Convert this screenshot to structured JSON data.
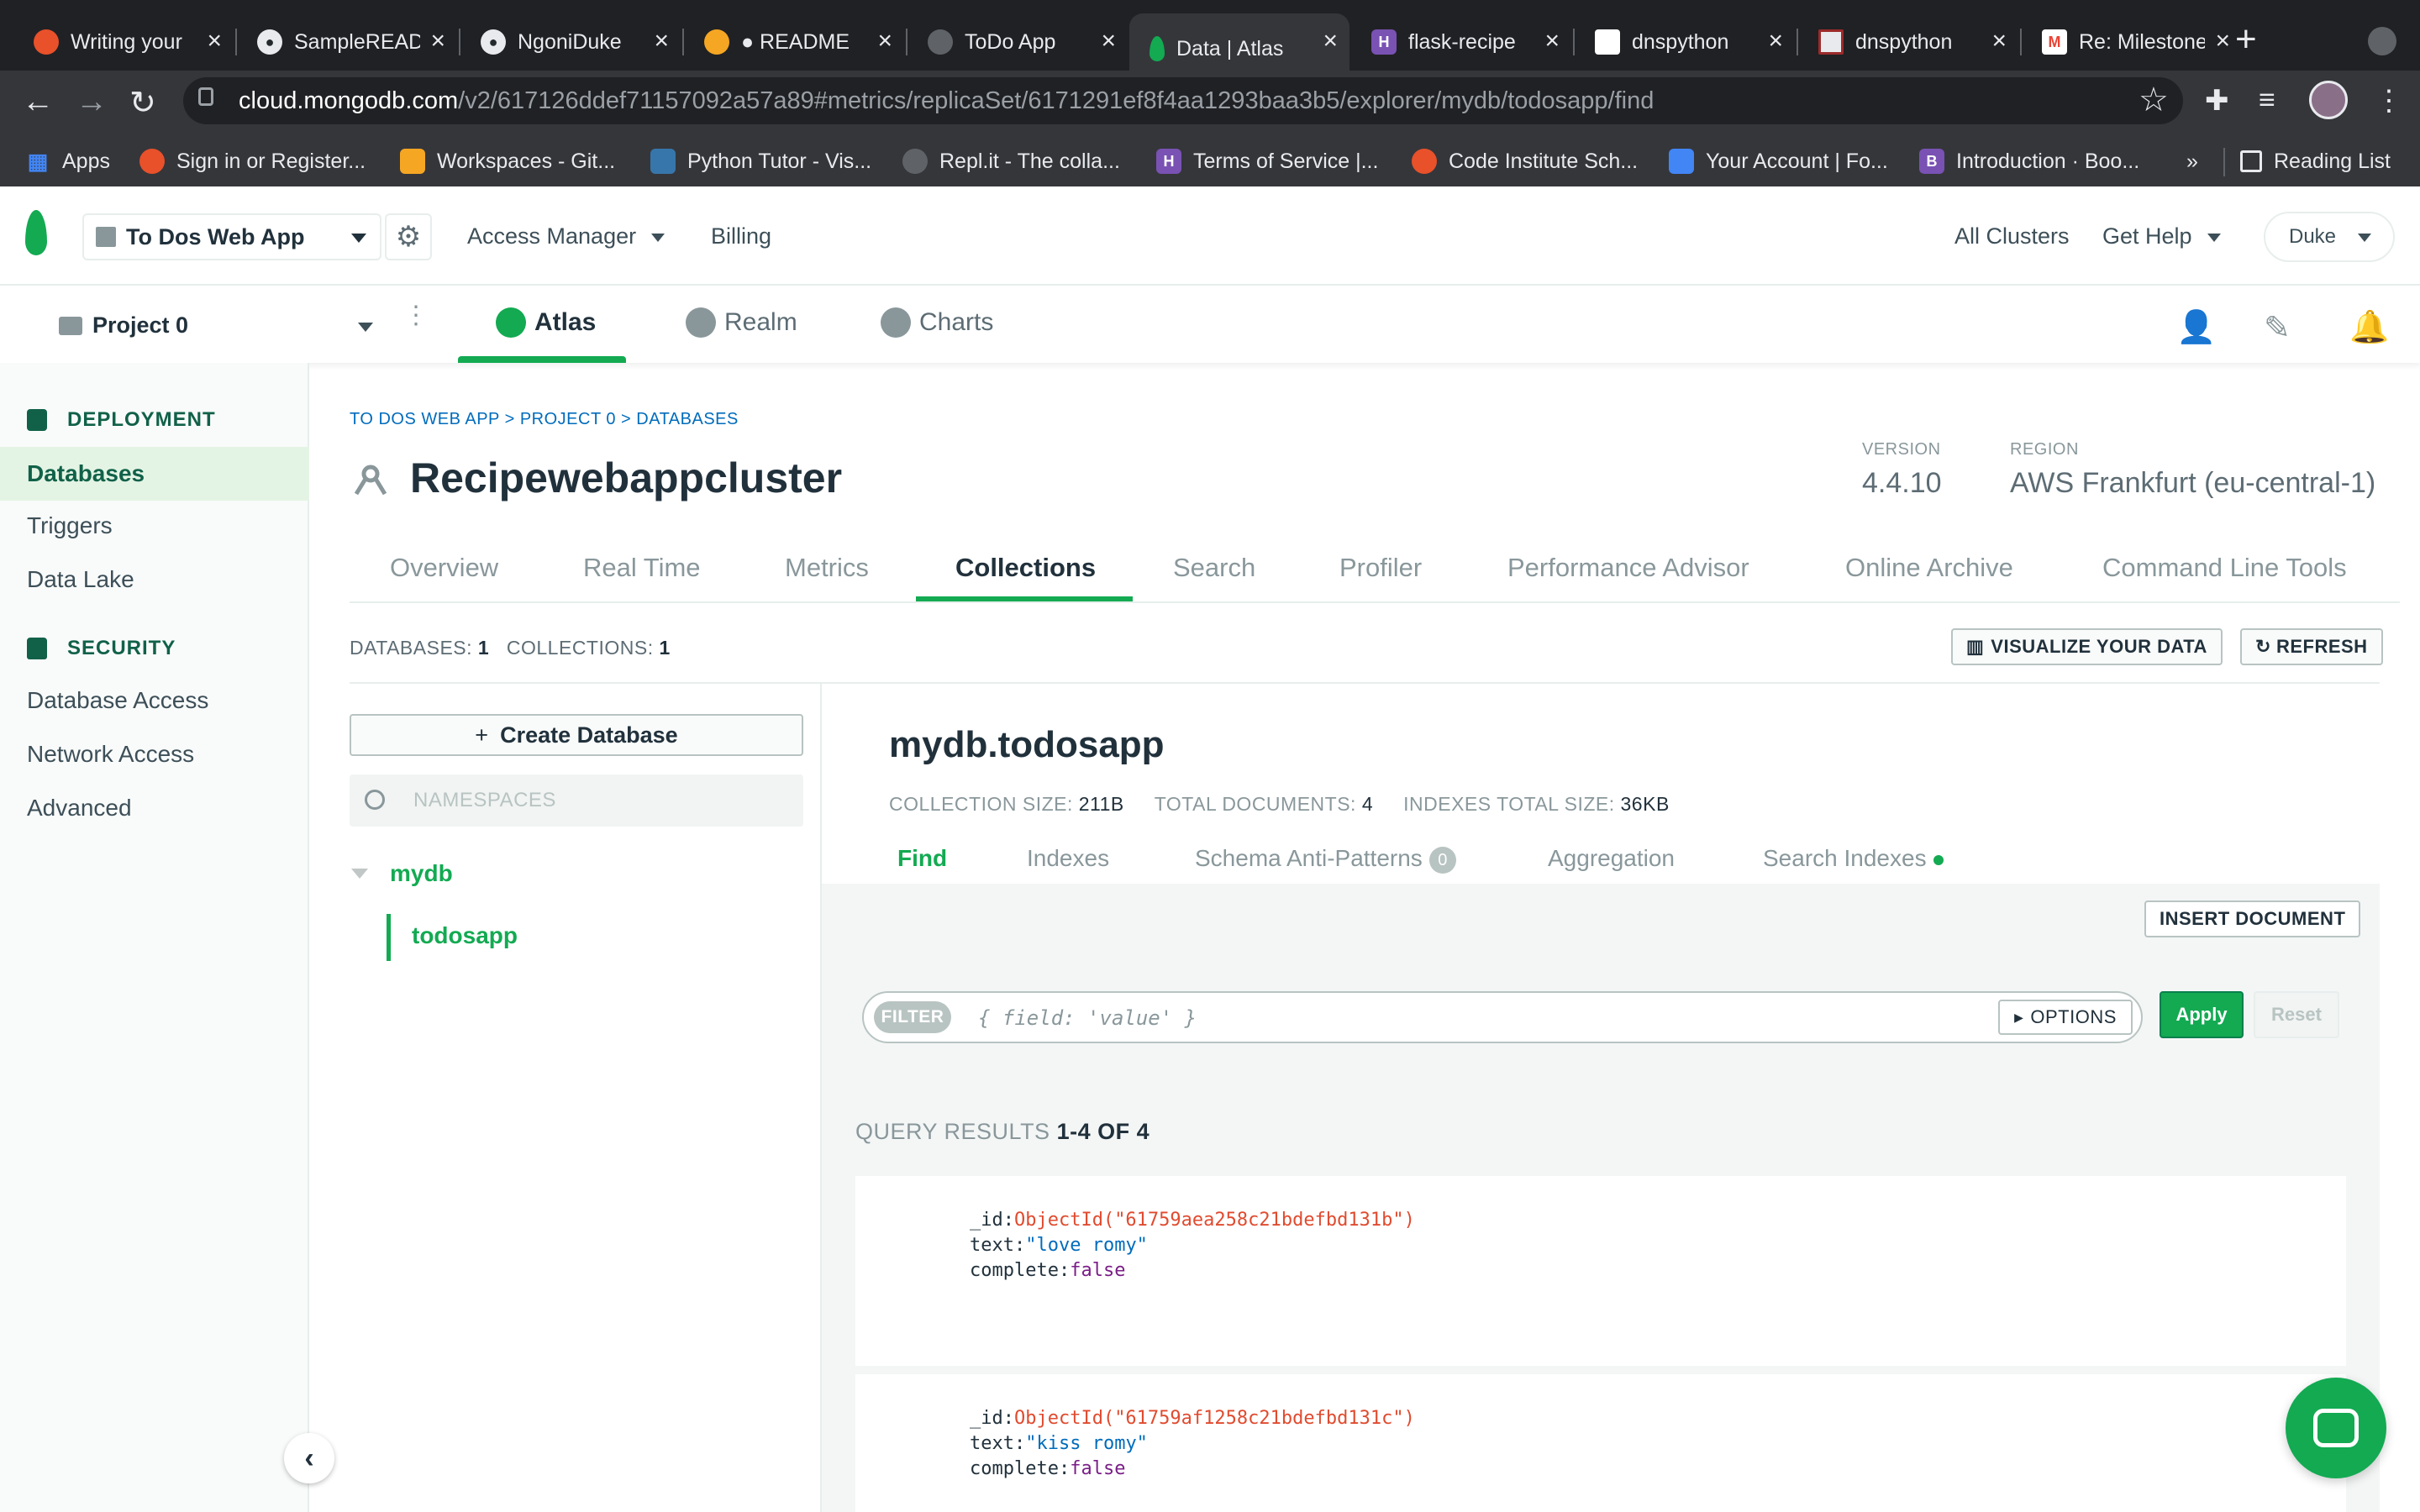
{
  "browser": {
    "tabs": [
      {
        "title": "Writing your",
        "favicon_color": "#e8512a"
      },
      {
        "title": "SampleREADME",
        "favicon_color": "#24292e"
      },
      {
        "title": "NgoniDuke",
        "favicon_color": "#24292e"
      },
      {
        "title": "● README",
        "favicon_color": "#f5a623"
      },
      {
        "title": "ToDo App",
        "favicon_color": "#5f6368"
      },
      {
        "title": "Data | Atlas",
        "favicon_color": "#13aa52"
      },
      {
        "title": "flask-recipe",
        "favicon_color": "#7952b3"
      },
      {
        "title": "dnspython",
        "favicon_color": "#ffffff"
      },
      {
        "title": "dnspython",
        "favicon_color": "#e8eaed"
      },
      {
        "title": "Re: Milestone",
        "favicon_color": "#ea4335"
      }
    ],
    "url_host": "cloud.mongodb.com",
    "url_path": "/v2/617126ddef71157092a57a89#metrics/replicaSet/6171291ef8f4aa1293baa3b5/explorer/mydb/todosapp/find",
    "bookmarks": [
      {
        "label": "Apps",
        "color": "#4285f4"
      },
      {
        "label": "Sign in or Register...",
        "color": "#e8512a"
      },
      {
        "label": "Workspaces - Git...",
        "color": "#f5a623"
      },
      {
        "label": "Python Tutor - Vis...",
        "color": "#3776ab"
      },
      {
        "label": "Repl.it - The colla...",
        "color": "#5f6368"
      },
      {
        "label": "Terms of Service |...",
        "color": "#7952b3"
      },
      {
        "label": "Code Institute Sch...",
        "color": "#e8512a"
      },
      {
        "label": "Your Account | Fo...",
        "color": "#4285f4"
      },
      {
        "label": "Introduction · Boo...",
        "color": "#7952b3"
      }
    ],
    "bookmarks_more": "»",
    "reading_list": "Reading List"
  },
  "topnav": {
    "org": "To Dos Web App",
    "access_manager": "Access Manager",
    "billing": "Billing",
    "all_clusters": "All Clusters",
    "get_help": "Get Help",
    "user": "Duke"
  },
  "projnav": {
    "project": "Project 0",
    "tabs": [
      "Atlas",
      "Realm",
      "Charts"
    ]
  },
  "sidebar": {
    "deployment_heading": "DEPLOYMENT",
    "deployment_items": [
      "Databases",
      "Triggers",
      "Data Lake"
    ],
    "security_heading": "SECURITY",
    "security_items": [
      "Database Access",
      "Network Access",
      "Advanced"
    ]
  },
  "main": {
    "breadcrumb": "TO DOS WEB APP > PROJECT 0 > DATABASES",
    "cluster_name": "Recipewebappcluster",
    "version_label": "VERSION",
    "version": "4.4.10",
    "region_label": "REGION",
    "region": "AWS Frankfurt (eu-central-1)",
    "tabs": [
      "Overview",
      "Real Time",
      "Metrics",
      "Collections",
      "Search",
      "Profiler",
      "Performance Advisor",
      "Online Archive",
      "Command Line Tools"
    ],
    "databases_label": "DATABASES:",
    "databases_count": "1",
    "collections_label": "COLLECTIONS:",
    "collections_count": "1",
    "visualize": "VISUALIZE YOUR DATA",
    "refresh": "REFRESH"
  },
  "namespaces": {
    "create_db": "Create Database",
    "search_placeholder": "NAMESPACES",
    "db": "mydb",
    "collection": "todosapp"
  },
  "collection": {
    "title": "mydb.todosapp",
    "size_label": "COLLECTION SIZE:",
    "size": "211B",
    "docs_label": "TOTAL DOCUMENTS:",
    "docs": "4",
    "idx_label": "INDEXES TOTAL SIZE:",
    "idx": "36KB",
    "tabs": [
      "Find",
      "Indexes",
      "Schema Anti-Patterns",
      "Aggregation",
      "Search Indexes"
    ],
    "anti_pattern_count": "0",
    "insert": "INSERT DOCUMENT",
    "filter_label": "FILTER",
    "filter_placeholder": "{ field: 'value' }",
    "options": "OPTIONS",
    "apply": "Apply",
    "reset": "Reset",
    "results_label": "QUERY RESULTS",
    "results_range": "1-4 OF 4",
    "documents": [
      {
        "id": "ObjectId(\"61759aea258c21bdefbd131b\")",
        "text": "\"love romy\"",
        "complete": "false"
      },
      {
        "id": "ObjectId(\"61759af1258c21bdefbd131c\")",
        "text": "\"kiss romy\"",
        "complete": "false"
      }
    ],
    "key_id": "_id:",
    "key_text": "text:",
    "key_complete": "complete:"
  }
}
